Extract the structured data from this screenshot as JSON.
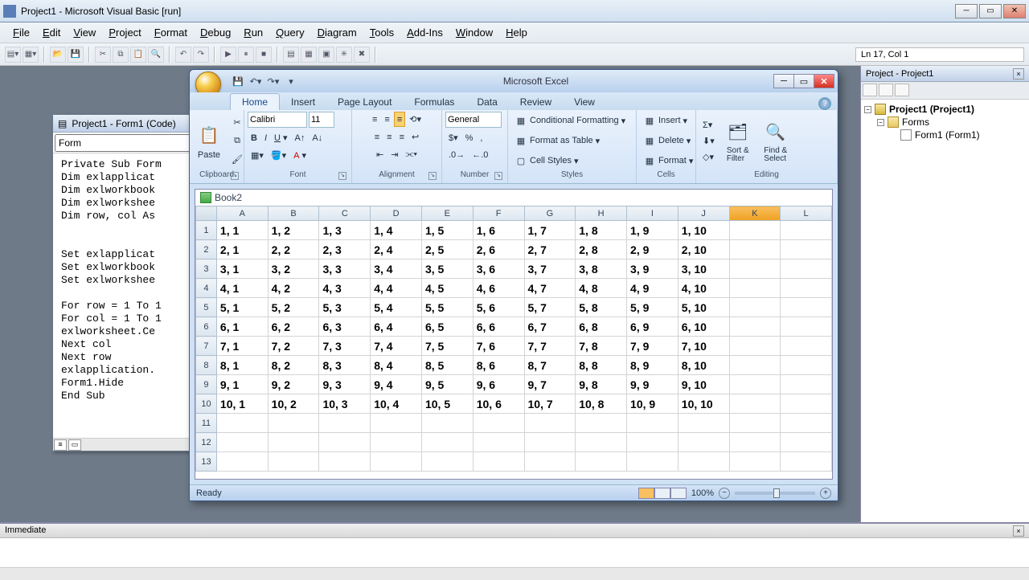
{
  "vb": {
    "title": "Project1 - Microsoft Visual Basic [run]",
    "menus": [
      "File",
      "Edit",
      "View",
      "Project",
      "Format",
      "Debug",
      "Run",
      "Query",
      "Diagram",
      "Tools",
      "Add-Ins",
      "Window",
      "Help"
    ],
    "cursor_status": "Ln 17, Col 1",
    "code_window_title": "Project1 - Form1 (Code)",
    "combo_object": "Form",
    "code": "Private Sub Form\nDim exlapplicat\nDim exlworkbook\nDim exlworkshee\nDim row, col As\n\n\nSet exlapplicat\nSet exlworkbook\nSet exlworkshee\n\nFor row = 1 To 1\nFor col = 1 To 1\nexlworksheet.Ce\nNext col\nNext row\nexlapplication.\nForm1.Hide\nEnd Sub",
    "immediate_title": "Immediate",
    "project_panel_title": "Project - Project1",
    "tree": {
      "root": "Project1 (Project1)",
      "folder": "Forms",
      "form": "Form1 (Form1)"
    }
  },
  "excel": {
    "title": "Microsoft Excel",
    "tabs": [
      "Home",
      "Insert",
      "Page Layout",
      "Formulas",
      "Data",
      "Review",
      "View"
    ],
    "active_tab": 0,
    "font_name": "Calibri",
    "font_size": "11",
    "number_format": "General",
    "groups": {
      "clipboard": "Clipboard",
      "font": "Font",
      "alignment": "Alignment",
      "number": "Number",
      "styles": "Styles",
      "cells": "Cells",
      "editing": "Editing"
    },
    "ribbon": {
      "paste": "Paste",
      "cond_fmt": "Conditional Formatting",
      "fmt_table": "Format as Table",
      "cell_styles": "Cell Styles",
      "insert": "Insert",
      "delete": "Delete",
      "format": "Format",
      "sort_filter": "Sort &\nFilter",
      "find_select": "Find &\nSelect"
    },
    "workbook_name": "Book2",
    "columns": [
      "A",
      "B",
      "C",
      "D",
      "E",
      "F",
      "G",
      "H",
      "I",
      "J",
      "K",
      "L"
    ],
    "selected_col": "K",
    "rows": 13,
    "data_rows": 10,
    "data_cols": 10,
    "status": "Ready",
    "zoom": "100%"
  }
}
